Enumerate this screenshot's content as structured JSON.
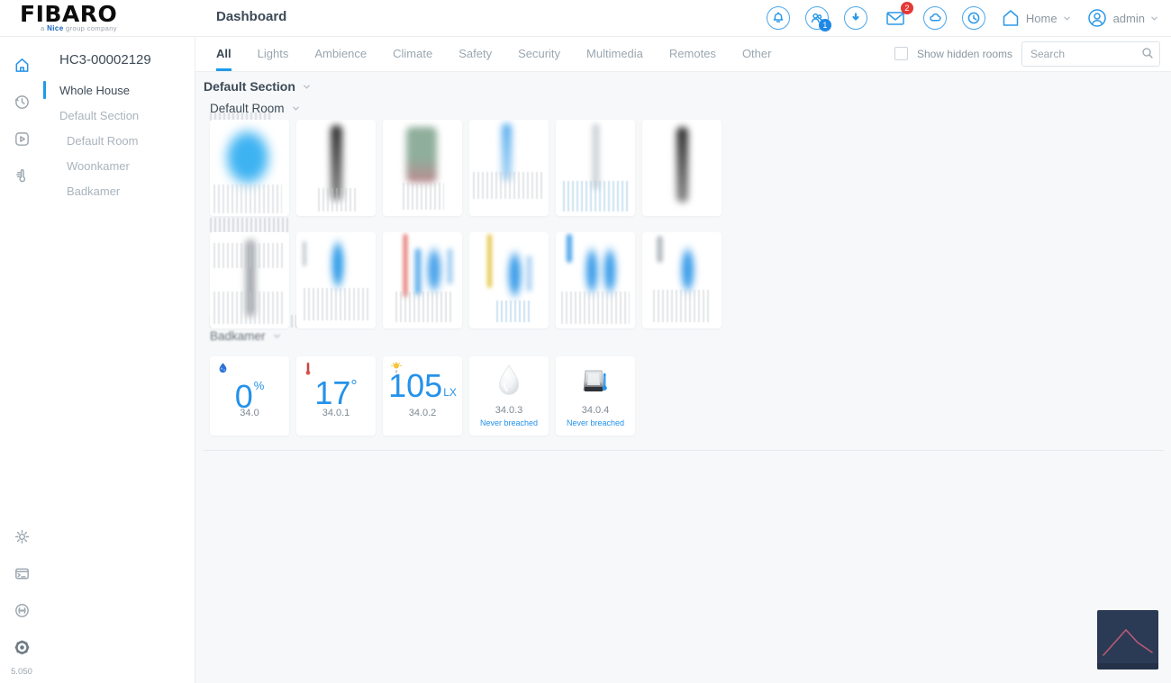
{
  "brand": {
    "logo": "FIBARO",
    "tagline_prefix": "a",
    "tagline_bold": "Nice",
    "tagline_suffix": "group company"
  },
  "header": {
    "title": "Dashboard",
    "home_label": "Home",
    "user_name": "admin",
    "users_badge": "1",
    "mail_badge": "2"
  },
  "tabs": {
    "items": [
      {
        "label": "All"
      },
      {
        "label": "Lights"
      },
      {
        "label": "Ambience"
      },
      {
        "label": "Climate"
      },
      {
        "label": "Safety"
      },
      {
        "label": "Security"
      },
      {
        "label": "Multimedia"
      },
      {
        "label": "Remotes"
      },
      {
        "label": "Other"
      }
    ],
    "active": "All"
  },
  "filters": {
    "show_hidden_label": "Show hidden rooms",
    "search_placeholder": "Search"
  },
  "sidebar": {
    "serial": "HC3-00002129",
    "items": [
      {
        "label": "Whole House"
      },
      {
        "label": "Default Section"
      },
      {
        "label": "Default Room"
      },
      {
        "label": "Woonkamer"
      },
      {
        "label": "Badkamer"
      }
    ],
    "active": "Whole House"
  },
  "rail": {
    "version": "5.050"
  },
  "content": {
    "section_title": "Default Section",
    "room1_title": "Default Room",
    "room2_title": "Badkamer"
  },
  "devices": {
    "badkamer": [
      {
        "kind": "humidity",
        "value": "0",
        "unit": "%",
        "label": "34.0"
      },
      {
        "kind": "temperature",
        "value": "17",
        "unit": "°",
        "label": "34.0.1"
      },
      {
        "kind": "luminosity",
        "value": "105",
        "unit": "LX",
        "label": "34.0.2"
      },
      {
        "kind": "flood-sensor",
        "label": "34.0.3",
        "status": "Never breached"
      },
      {
        "kind": "smoke-sensor",
        "label": "34.0.4",
        "status": "Never breached"
      }
    ]
  },
  "colors": {
    "accent_blue": "#1e9be9",
    "value_blue": "#2492ea",
    "badge_red": "#e53935",
    "badge_blue": "#1e88e5",
    "widget_bg": "#2b3a55",
    "widget_line": "#d0607a"
  }
}
